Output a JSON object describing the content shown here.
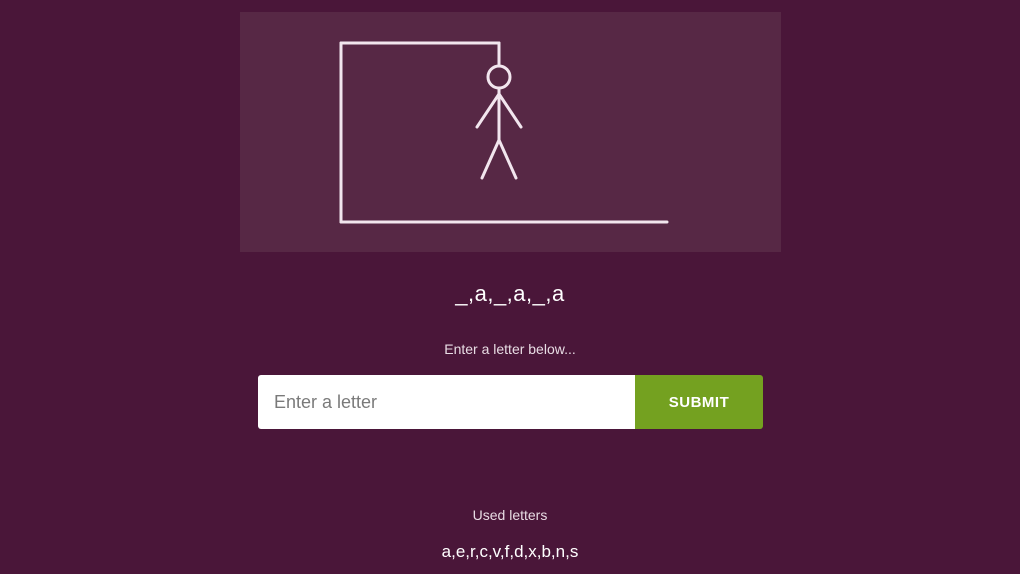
{
  "game": {
    "word_display": "_,a,_,a,_,a",
    "prompt": "Enter a letter below...",
    "input_placeholder": "Enter a letter",
    "input_value": "",
    "submit_label": "SUBMIT",
    "used_letters_title": "Used letters",
    "used_letters": "a,e,r,c,v,f,d,x,b,n,s"
  },
  "hangman": {
    "parts_shown": [
      "head",
      "body",
      "left-arm",
      "right-arm",
      "left-leg",
      "right-leg"
    ],
    "colors": {
      "panel": "#572845",
      "stroke": "#f2e6ee"
    }
  },
  "colors": {
    "background": "#4a1639",
    "submit": "#74a120",
    "text": "#ffffff"
  }
}
